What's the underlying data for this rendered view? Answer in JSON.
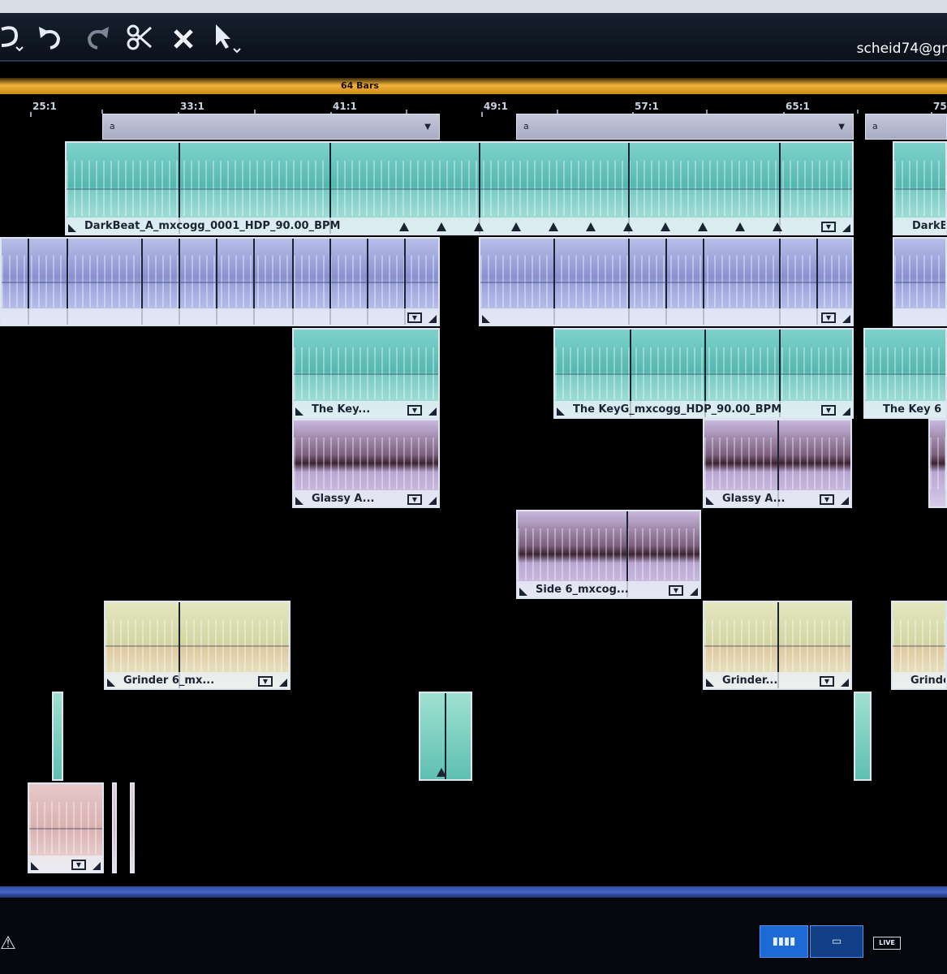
{
  "toolbar": {
    "user": "scheid74@gr",
    "icons": [
      "loop-icon",
      "undo-icon",
      "redo-icon",
      "split-icon",
      "delete-icon",
      "pointer-tool-icon"
    ]
  },
  "timeline": {
    "length_label": "64 Bars",
    "bar_labels": [
      "25:1",
      "33:1",
      "41:1",
      "49:1",
      "57:1",
      "65:1",
      "75"
    ]
  },
  "markers": [
    {
      "label": "a"
    },
    {
      "label": "a"
    },
    {
      "label": "a"
    }
  ],
  "clips": {
    "beat": "DarkBeat_A_mxcogg_0001_HDP_90.00_BPM",
    "keys_a": "The Key...",
    "keys_b": "The KeyG_mxcogg_HDP_90.00_BPM",
    "keys_c": "The Key 6",
    "glassy_a": "Glassy A...",
    "glassy_b": "Glassy A...",
    "side": "Side 6_mxcog...",
    "grinder_a": "Grinder 6_mx...",
    "grinder_b": "Grinder...",
    "grinder_c": "Grinder",
    "beat_c": "DarkB"
  },
  "footer": {
    "live_label": "LIVE",
    "view_buttons": [
      "bars-view-icon",
      "clip-view-icon"
    ]
  },
  "colors": {
    "teal": "#7fd2cc",
    "lavender": "#b8bfe9",
    "purple": "#7c5f7d",
    "cream": "#e4e7bf",
    "accent_orange": "#f2b33a",
    "accent_blue": "#1b6ad6"
  }
}
